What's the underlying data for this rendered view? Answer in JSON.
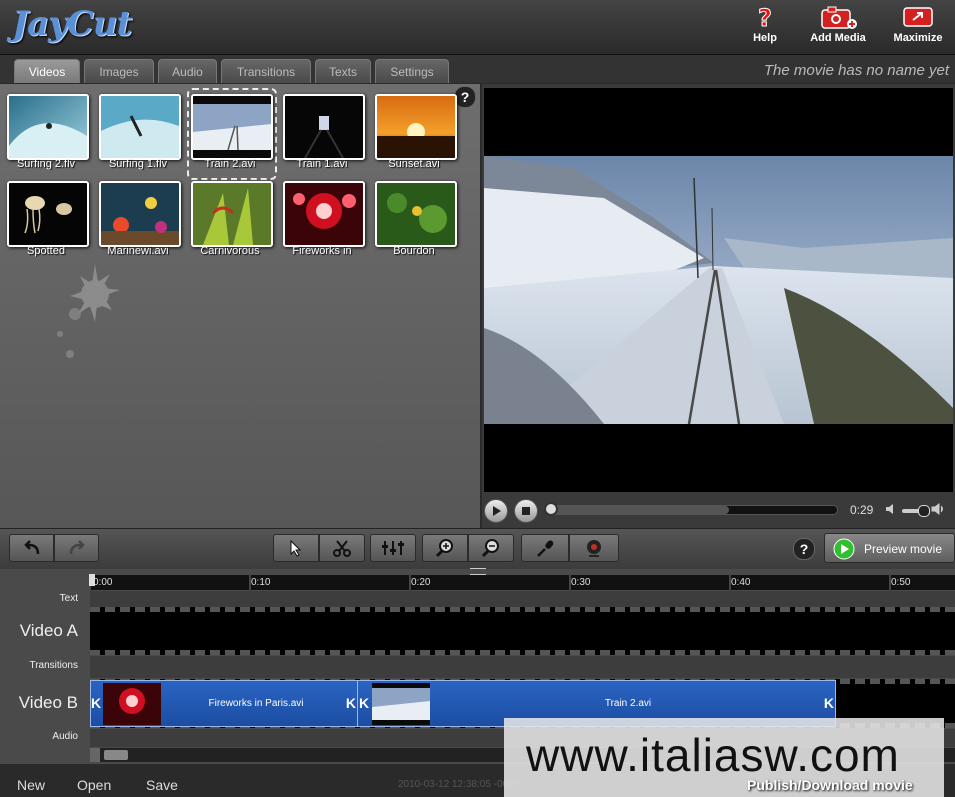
{
  "app": {
    "logo": "JayCut"
  },
  "header": {
    "help_label": "Help",
    "add_media_label": "Add Media",
    "maximize_label": "Maximize"
  },
  "tabs": [
    "Videos",
    "Images",
    "Audio",
    "Transitions",
    "Texts",
    "Settings"
  ],
  "active_tab": "Videos",
  "movie_name": "The movie has no name yet",
  "library": {
    "help": "?",
    "items": [
      {
        "label": "Surfing 2.flv"
      },
      {
        "label": "Surfing 1.flv"
      },
      {
        "label": "Train 2.avi"
      },
      {
        "label": "Train 1.avi"
      },
      {
        "label": "Sunset.avi"
      },
      {
        "label": "Spotted"
      },
      {
        "label": "Marinewi.avi"
      },
      {
        "label": "Carnivorous"
      },
      {
        "label": "Fireworks in"
      },
      {
        "label": "Bourdon"
      }
    ]
  },
  "player": {
    "time": "0:29",
    "progress": 0.63,
    "volume": 0.7
  },
  "toolbar": {
    "help": "?",
    "preview_label": "Preview movie"
  },
  "timeline": {
    "ticks": [
      "0:00",
      "0:10",
      "0:20",
      "0:30",
      "0:40",
      "0:50"
    ],
    "tracks": {
      "text": "Text",
      "video_a": "Video A",
      "transitions": "Transitions",
      "video_b": "Video B",
      "audio": "Audio"
    },
    "clips": [
      {
        "label": "Fireworks in Paris.avi"
      },
      {
        "label": "Train 2.avi"
      }
    ]
  },
  "bottom": {
    "new_label": "New",
    "open_label": "Open",
    "save_label": "Save",
    "timestamp": "2010-03-12 12:38:05 -0077",
    "publish_label": "Publish/Download movie"
  },
  "watermark": "www.italiasw.com",
  "colors": {
    "clip_blue": "#1f55ad",
    "accent_red": "#d32020",
    "play_green": "#2fbf2f"
  }
}
